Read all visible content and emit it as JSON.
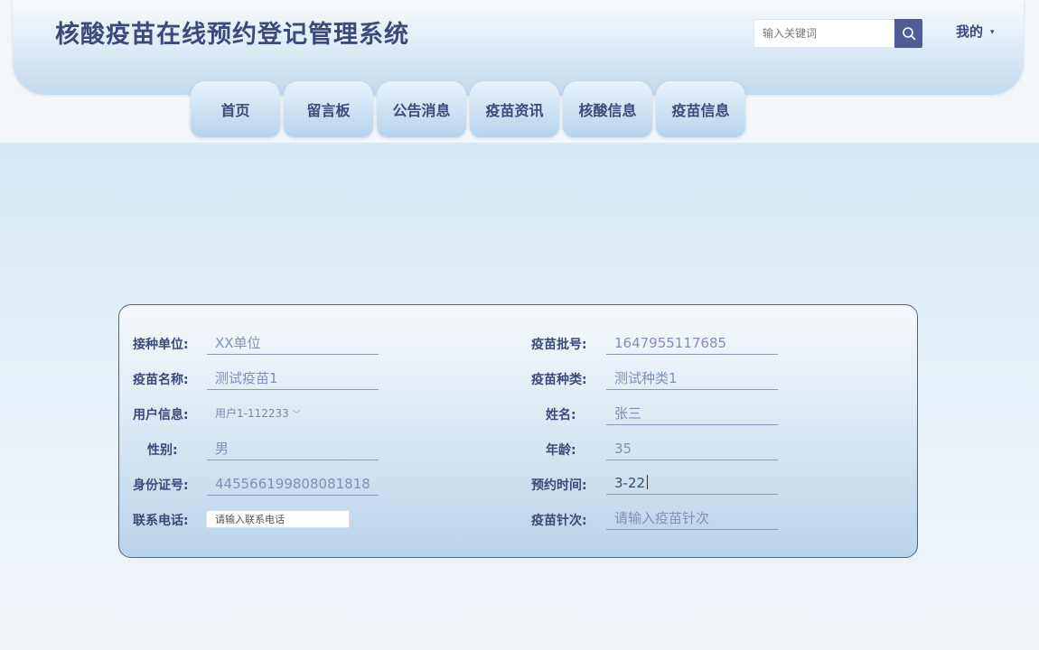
{
  "header": {
    "title": "核酸疫苗在线预约登记管理系统",
    "search_placeholder": "输入关键词",
    "search_icon": "search-icon",
    "user_menu_label": "我的"
  },
  "nav": {
    "tabs": [
      "首页",
      "留言板",
      "公告消息",
      "疫苗资讯",
      "核酸信息",
      "疫苗信息"
    ]
  },
  "form": {
    "fields": {
      "unit_label": "接种单位:",
      "unit_value": "XX单位",
      "batch_label": "疫苗批号:",
      "batch_value": "1647955117685",
      "vaccine_name_label": "疫苗名称:",
      "vaccine_name_value": "测试疫苗1",
      "vaccine_type_label": "疫苗种类:",
      "vaccine_type_value": "测试种类1",
      "user_info_label": "用户信息:",
      "user_info_value": "用户1-112233",
      "name_label": "姓名:",
      "name_value": "张三",
      "gender_label": "性别:",
      "gender_value": "男",
      "age_label": "年龄:",
      "age_value": "35",
      "id_label": "身份证号:",
      "id_value": "445566199808081818",
      "appt_time_label": "预约时间:",
      "appt_time_value": "3-22",
      "phone_label": "联系电话:",
      "phone_placeholder": "请输入联系电话",
      "dose_label": "疫苗针次:",
      "dose_placeholder": "请输入疫苗针次"
    }
  },
  "colors": {
    "primary": "#505c93",
    "title_text": "#3c4a7a",
    "card_border": "#4f5f8f"
  }
}
